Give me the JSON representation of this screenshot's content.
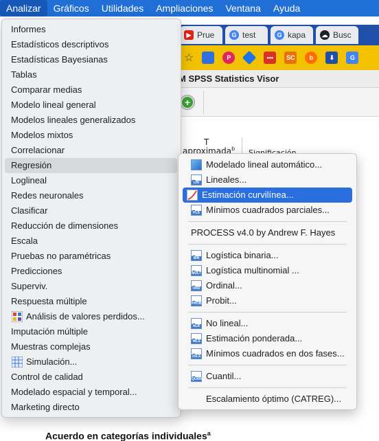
{
  "menubar": {
    "items": [
      "Analizar",
      "Gráficos",
      "Utilidades",
      "Ampliaciones",
      "Ventana",
      "Ayuda"
    ],
    "active": "Analizar"
  },
  "browser": {
    "tabs": [
      {
        "label": "Prue",
        "icon": "youtube-icon",
        "color": "#e62117"
      },
      {
        "label": "test",
        "icon": "google-icon",
        "color": "#4285f4"
      },
      {
        "label": "kapa",
        "icon": "google-icon",
        "color": "#4285f4"
      },
      {
        "label": "Busc",
        "icon": "search-engine-icon",
        "color": "#202124"
      }
    ],
    "bookmark_colors": [
      "#2f6fe0",
      "#e0245e",
      "#1a73e8",
      "#d93025",
      "#e8710a",
      "#ff6d00",
      "#1f4fa8",
      "#4285f4"
    ],
    "bookmark_labels": {
      "sc": "SC"
    }
  },
  "viewer": {
    "title": "M SPSS Statistics Visor",
    "output": {
      "col_t": "T",
      "col_aprox": "aproximada",
      "col_aprox_sup": "b",
      "col_sig": "Significación",
      "heading": "Acuerdo en categorías individuales",
      "heading_sup": "a"
    }
  },
  "analyze_menu": {
    "items": [
      "Informes",
      "Estadísticos descriptivos",
      "Estadísticas Bayesianas",
      "Tablas",
      "Comparar medias",
      "Modelo lineal general",
      "Modelos lineales generalizados",
      "Modelos mixtos",
      "Correlacionar",
      "Regresión",
      "Loglineal",
      "Redes neuronales",
      "Clasificar",
      "Reducción de dimensiones",
      "Escala",
      "Pruebas no paramétricas",
      "Predicciones",
      "Superviv.",
      "Respuesta múltiple",
      "Análisis de valores perdidos...",
      "Imputación múltiple",
      "Muestras complejas",
      "Simulación...",
      "Control de calidad",
      "Modelado espacial y temporal...",
      "Marketing directo"
    ],
    "highlighted": "Regresión"
  },
  "regression_submenu": {
    "group1": [
      {
        "label": "Modelado lineal automático...",
        "icon": "auto-linear-icon"
      },
      {
        "label": "Lineales...",
        "icon": "linear-regression-icon",
        "tag": "LIN"
      },
      {
        "label": "Estimación curvilínea...",
        "icon": "curve-estimation-icon",
        "selected": true
      },
      {
        "label": "Mínimos cuadrados parciales...",
        "icon": "pls-icon",
        "tag": "PLS"
      }
    ],
    "group2": [
      {
        "label": "PROCESS v4.0 by Andrew F. Hayes"
      }
    ],
    "group3": [
      {
        "label": "Logística binaria...",
        "icon": "binary-logistic-icon",
        "tag": "BIN"
      },
      {
        "label": "Logística multinomial ...",
        "icon": "multinomial-logistic-icon",
        "tag": "MULT"
      },
      {
        "label": "Ordinal...",
        "icon": "ordinal-icon",
        "tag": "ORD"
      },
      {
        "label": "Probit...",
        "icon": "probit-icon",
        "tag": "PROB"
      }
    ],
    "group4": [
      {
        "label": "No lineal...",
        "icon": "nonlinear-icon",
        "tag": "NLR"
      },
      {
        "label": "Estimación ponderada...",
        "icon": "weighted-estimation-icon",
        "tag": "WLS"
      },
      {
        "label": "Mínimos cuadrados en dos fases...",
        "icon": "two-stage-least-squares-icon",
        "tag": "2SLS"
      }
    ],
    "group5": [
      {
        "label": "Cuantil...",
        "icon": "quantile-icon",
        "tag": "QUAN"
      }
    ],
    "group6": [
      {
        "label": "Escalamiento óptimo (CATREG)..."
      }
    ]
  },
  "colors": {
    "menubar": "#1f6fd6",
    "selection": "#2a6ee0",
    "bookmark_bar": "#f2c200"
  }
}
